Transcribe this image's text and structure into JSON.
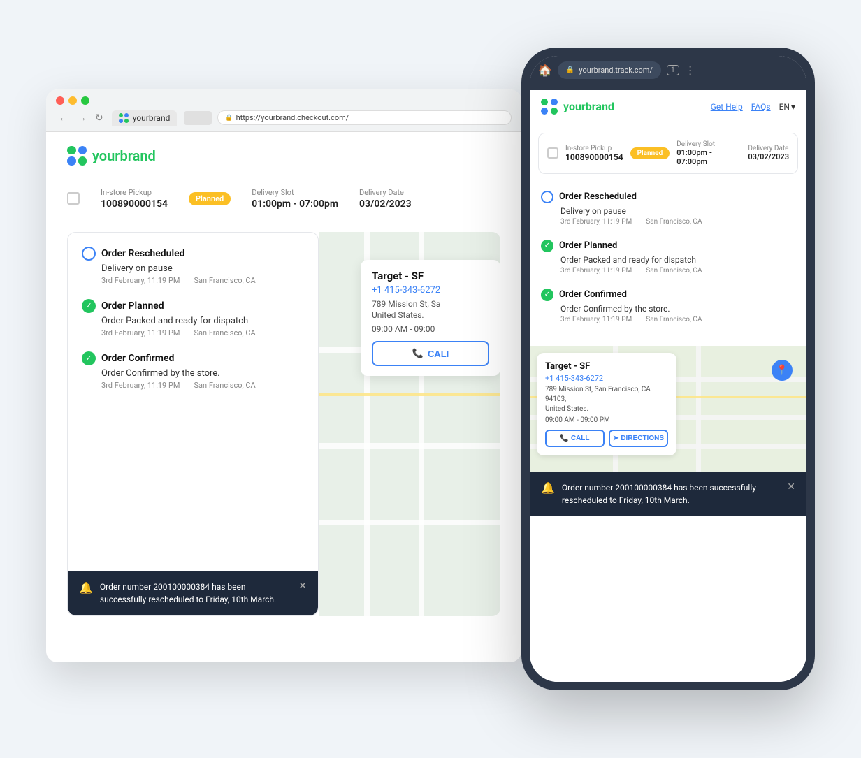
{
  "desktop": {
    "browser": {
      "dots": [
        "red",
        "yellow",
        "green"
      ],
      "tab_label": "yourbrand",
      "address": "https://yourbrand.checkout.com/",
      "new_tab": "+"
    },
    "brand": {
      "name": "yourbrand"
    },
    "order": {
      "label_pickup": "In-store Pickup",
      "order_number": "100890000154",
      "status": "Planned",
      "label_slot": "Delivery Slot",
      "slot_value": "01:00pm - 07:00pm",
      "label_date": "Delivery Date",
      "date_value": "03/02/2023"
    },
    "timeline": [
      {
        "type": "circle",
        "title": "Order Rescheduled",
        "subtitle": "Delivery on pause",
        "date": "3rd February, 11:19 PM",
        "location": "San Francisco, CA"
      },
      {
        "type": "check",
        "title": "Order Planned",
        "subtitle": "Order Packed and ready for dispatch",
        "date": "3rd February, 11:19 PM",
        "location": "San Francisco, CA"
      },
      {
        "type": "check",
        "title": "Order Confirmed",
        "subtitle": "Order Confirmed by the store.",
        "date": "3rd February, 11:19 PM",
        "location": "San Francisco, CA"
      }
    ],
    "store": {
      "name": "Target - SF",
      "phone": "+1 415-343-6272",
      "address": "789 Mission St, Sa",
      "country": "United States.",
      "hours": "09:00 AM - 09:00",
      "call_label": "CALI"
    },
    "notification": {
      "message": "Order number 200100000384 has been successfully rescheduled to Friday, 10th March.",
      "bell": "🔔"
    }
  },
  "mobile": {
    "browser": {
      "url": "yourbrand.track.com/",
      "tab_count": "1"
    },
    "brand": {
      "name": "yourbrand",
      "nav_help": "Get Help",
      "nav_faq": "FAQs",
      "lang": "EN"
    },
    "order": {
      "label_pickup": "In-store Pickup",
      "order_number": "100890000154",
      "status": "Planned",
      "label_slot": "Delivery Slot",
      "slot_value": "01:00pm - 07:00pm",
      "label_date": "Delivery Date",
      "date_value": "03/02/2023"
    },
    "timeline": [
      {
        "type": "circle",
        "title": "Order Rescheduled",
        "subtitle": "Delivery on pause",
        "date": "3rd February, 11:19 PM",
        "location": "San Francisco, CA"
      },
      {
        "type": "check",
        "title": "Order Planned",
        "subtitle": "Order Packed and ready for dispatch",
        "date": "3rd February, 11:19 PM",
        "location": "San Francisco, CA"
      },
      {
        "type": "check",
        "title": "Order Confirmed",
        "subtitle": "Order Confirmed by the store.",
        "date": "3rd February, 11:19 PM",
        "location": "San Francisco, CA"
      }
    ],
    "store": {
      "name": "Target - SF",
      "phone": "+1 415-343-6272",
      "address": "789 Mission St, San Francisco, CA 94103,",
      "country": "United States.",
      "hours": "09:00 AM - 09:00 PM",
      "call_label": "CALL",
      "directions_label": "DIRECTIONS"
    },
    "notification": {
      "message": "Order number 200100000384 has been successfully rescheduled to Friday, 10th March.",
      "bell": "🔔"
    }
  }
}
